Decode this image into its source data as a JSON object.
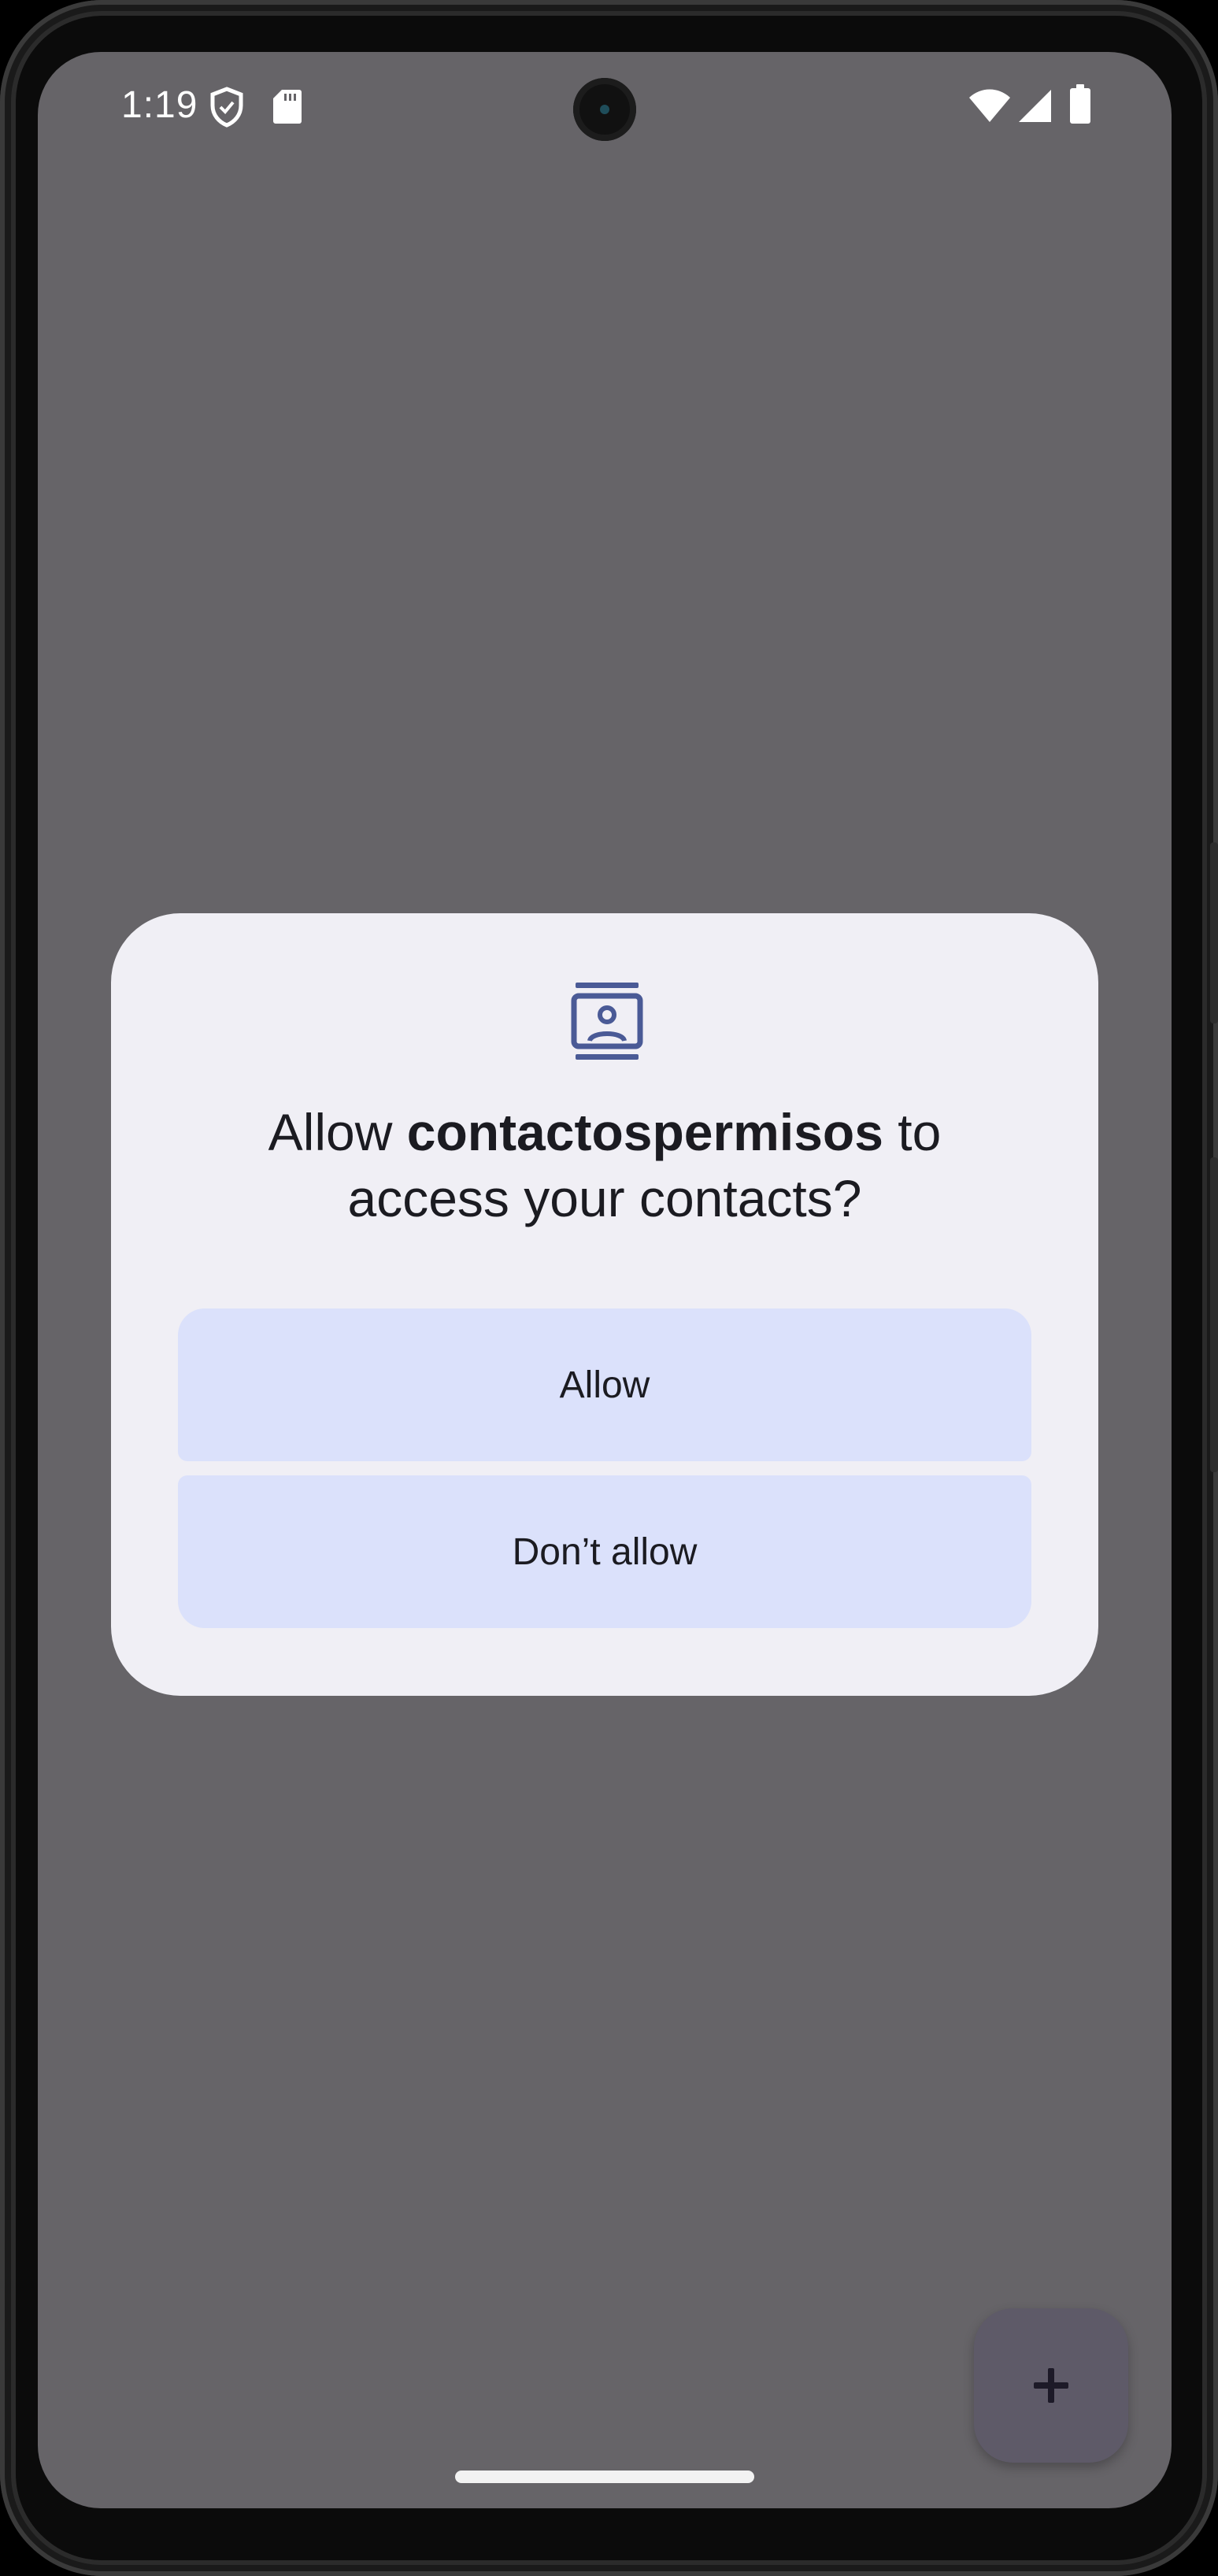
{
  "status_bar": {
    "time": "1:19",
    "icons": [
      "shield-icon",
      "sd-card-icon",
      "wifi-icon",
      "cellular-signal-icon",
      "battery-icon"
    ]
  },
  "dialog": {
    "icon": "contacts-icon",
    "title_prefix": "Allow ",
    "app_name": "contactospermisos",
    "title_suffix_line1": " to",
    "title_line2": "access your contacts?",
    "allow_label": "Allow",
    "deny_label": "Don’t allow"
  },
  "fab": {
    "icon": "plus-icon"
  },
  "colors": {
    "scrim": "#666468",
    "dialog_bg": "#f0eff5",
    "button_bg": "#dbe1fb",
    "icon_accent": "#4a5a96",
    "fab_bg": "#5e5a68"
  }
}
